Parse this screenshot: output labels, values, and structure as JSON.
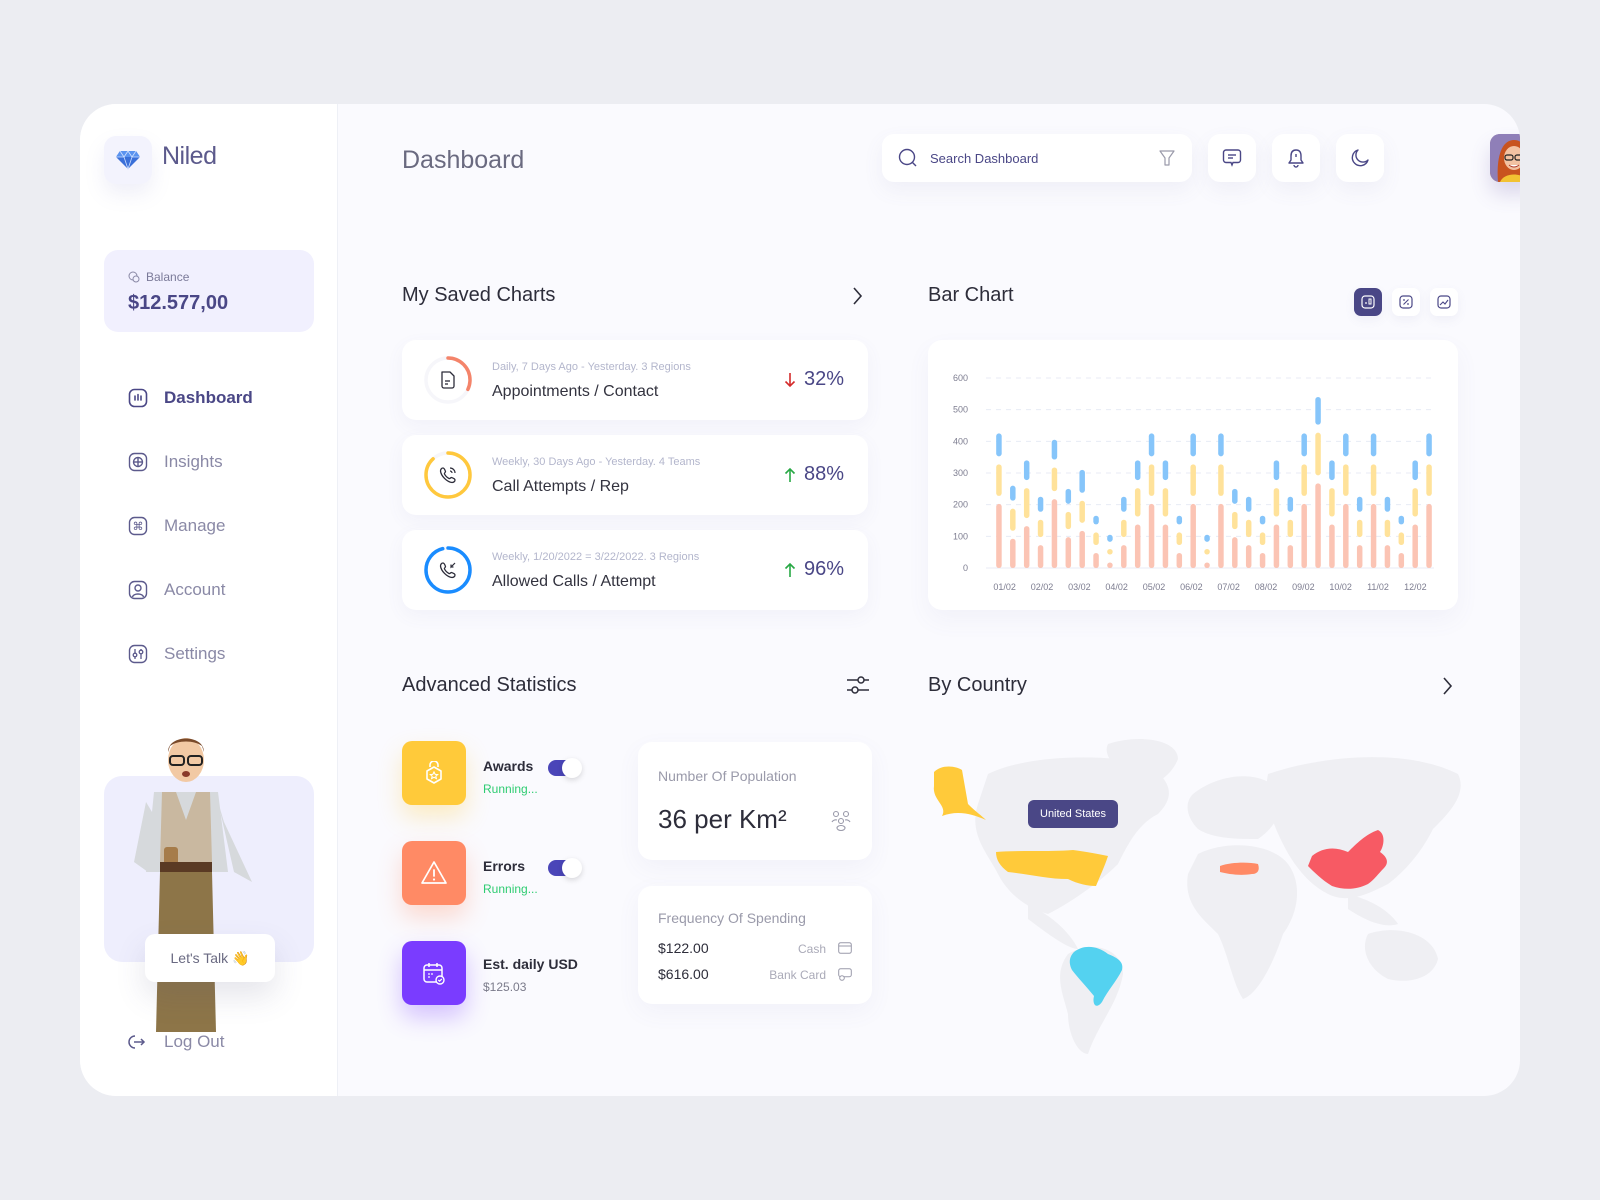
{
  "brand": {
    "name": "Niled",
    "logo_icon": "diamond-icon"
  },
  "balance": {
    "label": "Balance",
    "value": "$12.577,00",
    "icon": "coin-icon"
  },
  "sidebar": {
    "items": [
      {
        "label": "Dashboard",
        "icon": "dashboard-icon",
        "active": true
      },
      {
        "label": "Insights",
        "icon": "insights-icon",
        "active": false
      },
      {
        "label": "Manage",
        "icon": "command-icon",
        "active": false
      },
      {
        "label": "Account",
        "icon": "user-icon",
        "active": false
      },
      {
        "label": "Settings",
        "icon": "sliders-icon",
        "active": false
      }
    ],
    "promo_button": "Let's Talk 👋",
    "logout": "Log Out"
  },
  "header": {
    "title": "Dashboard",
    "search_placeholder": "Search Dashboard",
    "icons": [
      "search-icon",
      "filter-icon",
      "message-icon",
      "bell-icon",
      "moon-icon",
      "avatar"
    ]
  },
  "saved_charts": {
    "title": "My Saved Charts",
    "items": [
      {
        "subtitle": "Daily, 7 Days Ago - Yesterday. 3 Regions",
        "name": "Appointments / Contact",
        "percent": "32%",
        "progress": 0.32,
        "trend": "down",
        "color": "#f4846a",
        "icon": "document-icon"
      },
      {
        "subtitle": "Weekly, 30 Days Ago - Yesterday. 4 Teams",
        "name": "Call Attempts / Rep",
        "percent": "88%",
        "progress": 0.88,
        "trend": "up",
        "color": "#ffc83d",
        "icon": "phone-call-icon"
      },
      {
        "subtitle": "Weekly, 1/20/2022 = 3/22/2022. 3 Regions",
        "name": "Allowed Calls / Attempt",
        "percent": "96%",
        "progress": 0.96,
        "trend": "up",
        "color": "#1a8cff",
        "icon": "phone-incoming-icon"
      }
    ]
  },
  "bar_chart_section": {
    "title": "Bar Chart",
    "type_buttons": [
      "bar-chart-icon",
      "percent-icon",
      "image-chart-icon"
    ]
  },
  "chart_data": {
    "type": "bar",
    "title": "Bar Chart",
    "xlabel": "",
    "ylabel": "",
    "ylim": [
      0,
      600
    ],
    "yticks": [
      0,
      100,
      200,
      300,
      400,
      500,
      600
    ],
    "grid": true,
    "categories": [
      "01/02",
      "02/02",
      "03/02",
      "04/02",
      "05/02",
      "06/02",
      "07/02",
      "08/02",
      "09/02",
      "10/02",
      "11/02",
      "12/02"
    ],
    "stacked_segments": [
      "pink",
      "yellow",
      "blue"
    ],
    "colors": {
      "pink": "#fbc4b4",
      "yellow": "#ffe29a",
      "blue": "#86c5fa"
    },
    "bars": [
      [
        215,
        340,
        425
      ],
      [
        105,
        200,
        260
      ],
      [
        145,
        265,
        340
      ],
      [
        85,
        165,
        225
      ],
      [
        230,
        330,
        405
      ],
      [
        110,
        190,
        250
      ],
      [
        130,
        225,
        310
      ],
      [
        60,
        125,
        165
      ],
      [
        30,
        70,
        105
      ],
      [
        85,
        165,
        225
      ],
      [
        150,
        265,
        340
      ],
      [
        215,
        340,
        425
      ],
      [
        150,
        265,
        340
      ],
      [
        60,
        125,
        165
      ],
      [
        215,
        340,
        425
      ],
      [
        30,
        70,
        105
      ],
      [
        215,
        340,
        425
      ],
      [
        110,
        190,
        250
      ],
      [
        85,
        165,
        225
      ],
      [
        60,
        125,
        165
      ],
      [
        150,
        265,
        340
      ],
      [
        85,
        165,
        225
      ],
      [
        215,
        340,
        425
      ],
      [
        280,
        440,
        540
      ],
      [
        150,
        265,
        340
      ],
      [
        215,
        340,
        425
      ],
      [
        85,
        165,
        225
      ],
      [
        215,
        340,
        425
      ],
      [
        85,
        165,
        225
      ],
      [
        60,
        125,
        165
      ],
      [
        150,
        265,
        340
      ],
      [
        215,
        340,
        425
      ]
    ]
  },
  "advanced": {
    "title": "Advanced Statistics",
    "items": [
      {
        "label": "Awards",
        "status": "Running...",
        "toggle": true,
        "color": "#ffca3a",
        "icon": "award-icon"
      },
      {
        "label": "Errors",
        "status": "Running...",
        "toggle": true,
        "color": "#ff8a65",
        "icon": "warning-icon"
      },
      {
        "label": "Est. daily USD",
        "value": "$125.03",
        "color": "#7a3cff",
        "icon": "calendar-icon"
      }
    ],
    "population": {
      "label": "Number Of Population",
      "value": "36 per Km²"
    },
    "spending": {
      "label": "Frequency Of Spending",
      "rows": [
        {
          "amount": "$122.00",
          "method": "Cash",
          "icon": "cash-icon"
        },
        {
          "amount": "$616.00",
          "method": "Bank Card",
          "icon": "card-icon"
        }
      ]
    }
  },
  "by_country": {
    "title": "By Country",
    "tooltip": "United States",
    "highlighted": [
      {
        "country": "United States",
        "color": "#ffca3a"
      },
      {
        "country": "Brazil",
        "color": "#54d2f0"
      },
      {
        "country": "Turkey",
        "color": "#ff8a65"
      },
      {
        "country": "China",
        "color": "#f75a64"
      }
    ]
  }
}
